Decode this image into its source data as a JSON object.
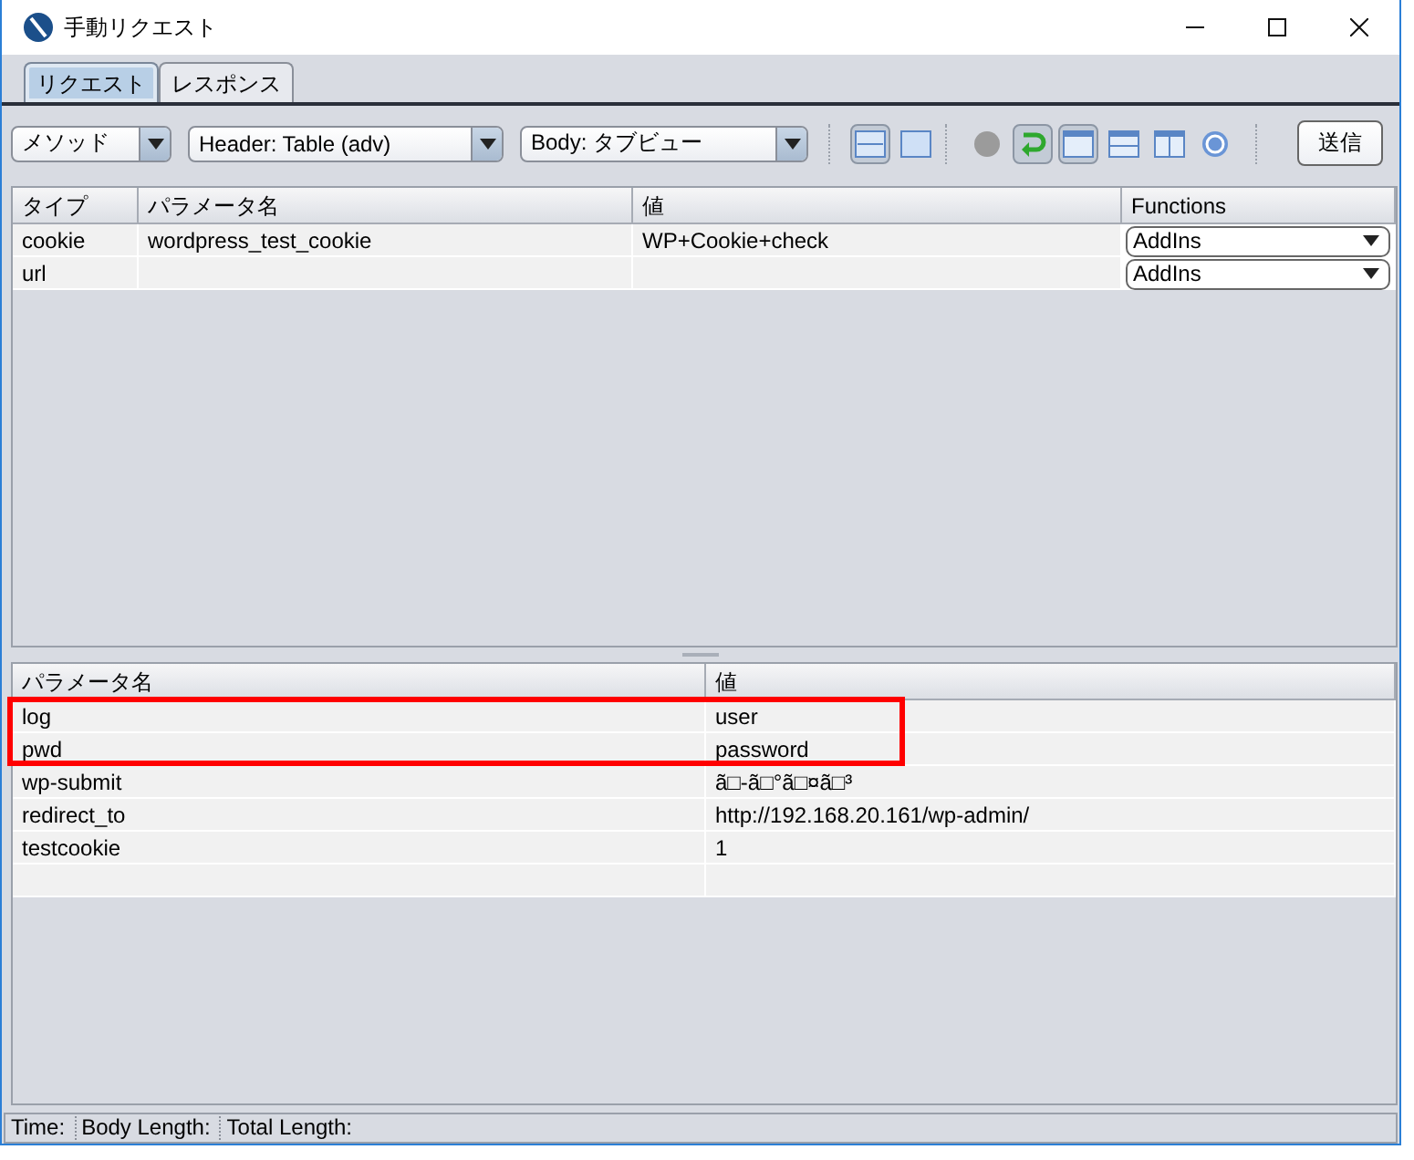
{
  "window": {
    "title": "手動リクエスト"
  },
  "tabs": [
    {
      "label": "リクエスト",
      "selected": true
    },
    {
      "label": "レスポンス",
      "selected": false
    }
  ],
  "toolbar": {
    "combos": [
      {
        "value": "メソッド"
      },
      {
        "value": "Header: Table (adv)"
      },
      {
        "value": "Body: タブビュー"
      }
    ],
    "icons": [
      {
        "kind": "split-h",
        "pressed": true
      },
      {
        "kind": "single",
        "pressed": false
      },
      {
        "kind": "dot",
        "pressed": false,
        "separator_before": true
      },
      {
        "kind": "return",
        "pressed": true
      },
      {
        "kind": "window",
        "pressed": true
      },
      {
        "kind": "rows",
        "pressed": false
      },
      {
        "kind": "cols",
        "pressed": false
      },
      {
        "kind": "help",
        "pressed": false
      }
    ],
    "send_button": "送信"
  },
  "header_table": {
    "columns": [
      "タイプ",
      "パラメータ名",
      "値",
      "Functions"
    ],
    "rows": [
      {
        "cells": [
          "cookie",
          "wordpress_test_cookie",
          "WP+Cookie+check"
        ],
        "function": "AddIns"
      },
      {
        "cells": [
          "url",
          "",
          ""
        ],
        "function": "AddIns"
      }
    ]
  },
  "body_table": {
    "columns": [
      "パラメータ名",
      "値"
    ],
    "rows": [
      {
        "cells": [
          "log",
          "user"
        ],
        "highlighted": true
      },
      {
        "cells": [
          "pwd",
          "password"
        ],
        "highlighted": true
      },
      {
        "cells": [
          "wp-submit",
          "ã□-ã□°ã□¤ã□³"
        ],
        "highlighted": false
      },
      {
        "cells": [
          "redirect_to",
          "http://192.168.20.161/wp-admin/"
        ],
        "highlighted": false
      },
      {
        "cells": [
          "testcookie",
          "1"
        ],
        "highlighted": false
      }
    ]
  },
  "status_bar": [
    "Time:",
    "Body Length:",
    "Total Length:"
  ]
}
